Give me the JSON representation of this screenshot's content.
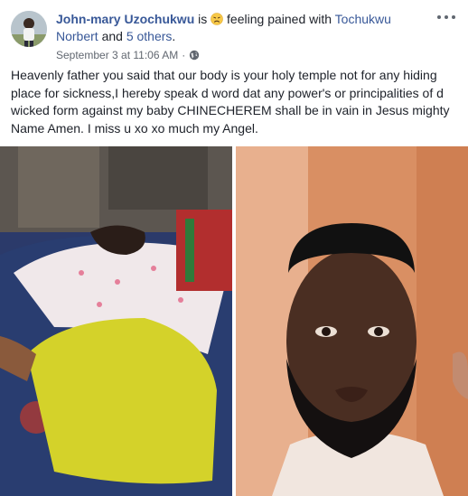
{
  "post": {
    "author": "John-mary Uzochukwu",
    "is_word": "is",
    "feeling_text": "feeling pained with",
    "tagged_person": "Tochukwu Norbert",
    "and_word": "and",
    "others_text": "5 others",
    "trailing_period": ".",
    "date": "September 3 at 11:06 AM",
    "separator": "·",
    "body": "Heavenly father you said that our body is your holy temple not for any hiding place for sickness,I hereby speak d word dat any power's or principalities of d wicked form against my baby CHINECHEREM shall be in vain in Jesus mighty Name Amen. I miss u xo xo much my Angel.",
    "icons": {
      "feeling": "pained-face-emoji",
      "privacy": "globe-icon",
      "menu": "more-options-icon"
    }
  },
  "colors": {
    "link": "#385898",
    "text": "#1d2129",
    "meta": "#616770"
  }
}
